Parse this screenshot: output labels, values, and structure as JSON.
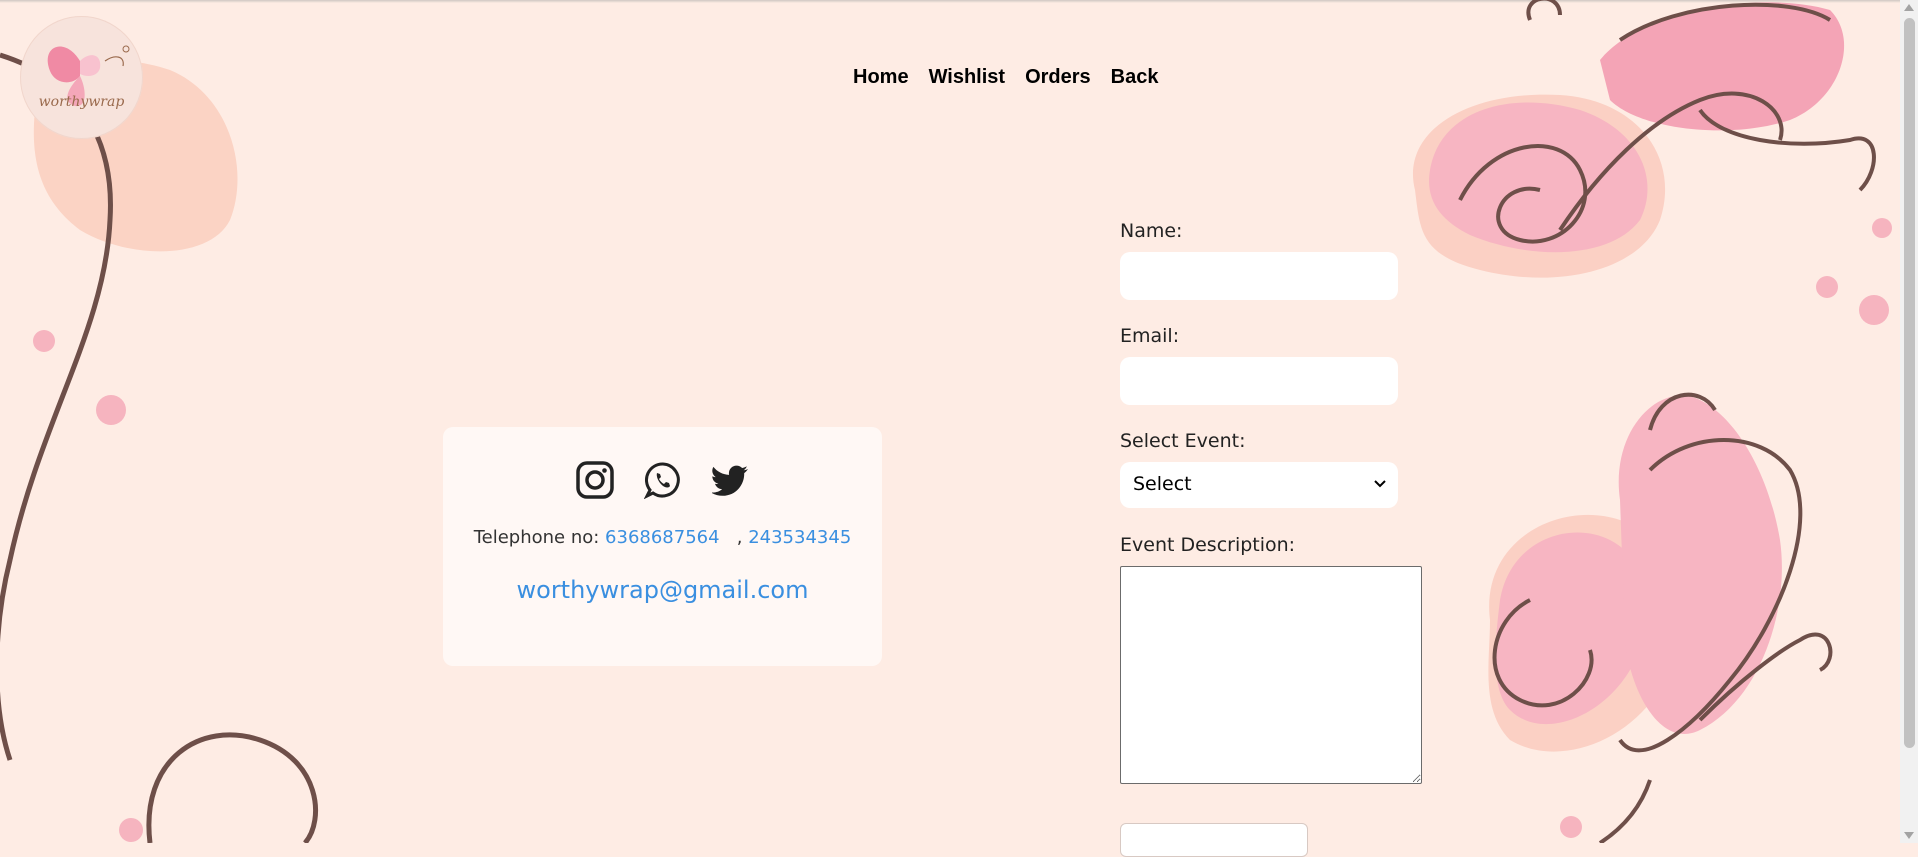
{
  "brand": {
    "name": "worthywrap"
  },
  "nav": {
    "home": "Home",
    "wishlist": "Wishlist",
    "orders": "Orders",
    "back": "Back"
  },
  "contact": {
    "social_icons": [
      "instagram-icon",
      "whatsapp-icon",
      "twitter-icon"
    ],
    "phone_label": "Telephone no: ",
    "phone_1": "6368687564",
    "phone_separator": ", ",
    "phone_2": "243534345",
    "email": "worthywrap@gmail.com",
    "link_color": "#3a8fe0"
  },
  "form": {
    "name_label": "Name:",
    "name_value": "",
    "email_label": "Email:",
    "email_value": "",
    "event_label": "Select Event:",
    "event_selected": "Select",
    "description_label": "Event Description:",
    "description_value": ""
  },
  "colors": {
    "background": "#feece4",
    "accent_pink": "#f7a9b9",
    "line_brown": "#6e4f49"
  }
}
